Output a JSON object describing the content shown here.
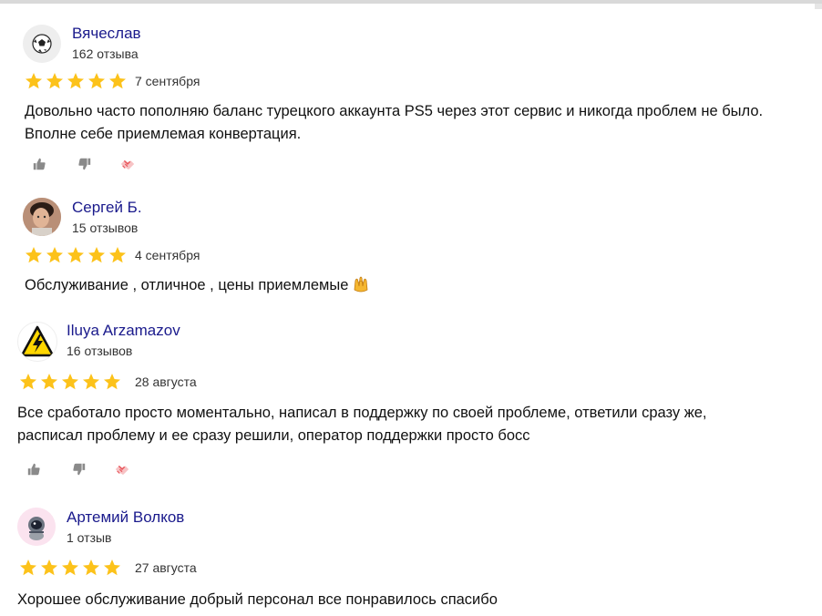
{
  "colors": {
    "name": "#1a1a8c",
    "star": "#fcc21a",
    "icon": "#8a8a8a",
    "icon_heart": "#e8545a"
  },
  "reviews": [
    {
      "author": "Вячеслав",
      "reviews_count": "162 отзыва",
      "rating": 5,
      "date": "7 сентября",
      "text_lines": [
        "Довольно часто пополняю баланс турецкого аккаунта PS5 через этот сервис и никогда проблем не было.",
        "Вполне себе приемлемая конвертация."
      ],
      "avatar_icon": "soccer-ball-icon"
    },
    {
      "author": "Сергей Б.",
      "reviews_count": "15 отзывов",
      "rating": 5,
      "date": "4 сентября",
      "text_lines": [
        "Обслуживание , отличное , цены приемлемые"
      ],
      "avatar_icon": "person-photo-icon",
      "trailing_emoji": "raised-hands-emoji"
    },
    {
      "author": "Iluya Arzamazov",
      "reviews_count": "16 отзывов",
      "rating": 5,
      "date": "28 августа",
      "text_lines": [
        "Все сработало просто моментально, написал в поддержку по своей проблеме, ответили сразу же,",
        "расписал проблему и ее сразу решили, оператор поддержки просто босс"
      ],
      "avatar_icon": "high-voltage-warning-icon"
    },
    {
      "author": "Артемий Волков",
      "reviews_count": "1 отзыв",
      "rating": 5,
      "date": "27 августа",
      "text_lines": [
        "Хорошее обслуживание добрый персонал все понравилось спасибо"
      ],
      "avatar_icon": "astronaut-icon"
    }
  ],
  "actions": [
    "like-icon",
    "dislike-icon",
    "thanks-icon"
  ]
}
